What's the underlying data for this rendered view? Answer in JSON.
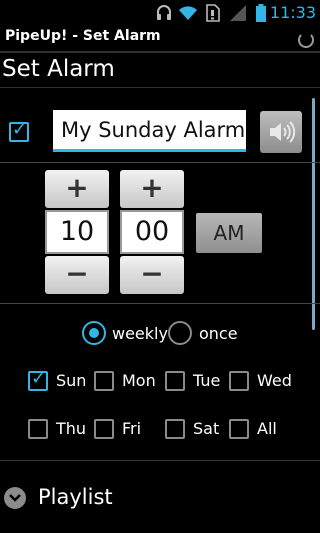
{
  "status_bar": {
    "time": "11:33",
    "icons": [
      "headset-icon",
      "wifi-icon",
      "sd-card-icon",
      "signal-icon",
      "battery-icon"
    ]
  },
  "title_bar": {
    "title": "PipeUp! - Set Alarm"
  },
  "header": {
    "title": "Set Alarm"
  },
  "alarm": {
    "enabled": true,
    "name": "My Sunday Alarm"
  },
  "time": {
    "hour": "10",
    "minute": "00",
    "ampm": "AM",
    "increment_label": "+",
    "decrement_label": "−"
  },
  "frequency": {
    "options": [
      "weekly",
      "once"
    ],
    "selected": "weekly"
  },
  "days": [
    {
      "label": "Sun",
      "checked": true
    },
    {
      "label": "Mon",
      "checked": false
    },
    {
      "label": "Tue",
      "checked": false
    },
    {
      "label": "Wed",
      "checked": false
    },
    {
      "label": "Thu",
      "checked": false
    },
    {
      "label": "Fri",
      "checked": false
    },
    {
      "label": "Sat",
      "checked": false
    },
    {
      "label": "All",
      "checked": false
    }
  ],
  "playlist": {
    "label": "Playlist"
  },
  "colors": {
    "accent": "#33b5e5",
    "background": "#000000"
  }
}
